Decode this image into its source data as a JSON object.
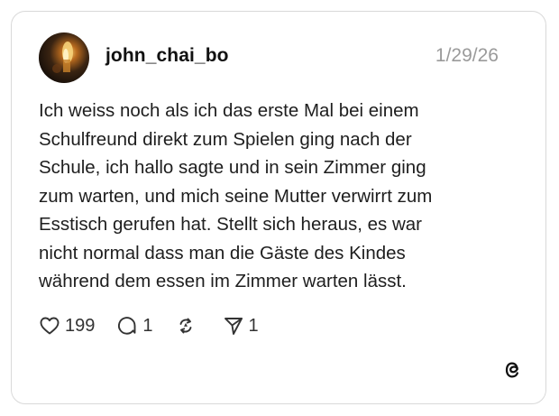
{
  "post": {
    "username": "john_chai_bo",
    "date": "1/29/26",
    "text": "Ich weiss noch als ich das erste Mal bei einem\nSchulfreund direkt zum Spielen ging nach der\nSchule, ich hallo sagte und in sein Zimmer ging\nzum warten, und mich seine Mutter verwirrt zum\nEsstisch gerufen hat. Stellt sich heraus, es war\nnicht normal dass man die Gäste des Kindes\nwährend dem essen im Zimmer warten lässt.",
    "avatar_icon": "flame-avatar"
  },
  "actions": {
    "likes": {
      "icon": "heart-icon",
      "count": "199"
    },
    "replies": {
      "icon": "comment-icon",
      "count": "1"
    },
    "reposts": {
      "icon": "repost-icon",
      "count": ""
    },
    "shares": {
      "icon": "send-icon",
      "count": "1"
    }
  },
  "branding": {
    "logo": "threads-logo-icon"
  },
  "colors": {
    "text": "#1e1e1e",
    "muted": "#9a9a9a",
    "border": "#d9d9d9"
  }
}
